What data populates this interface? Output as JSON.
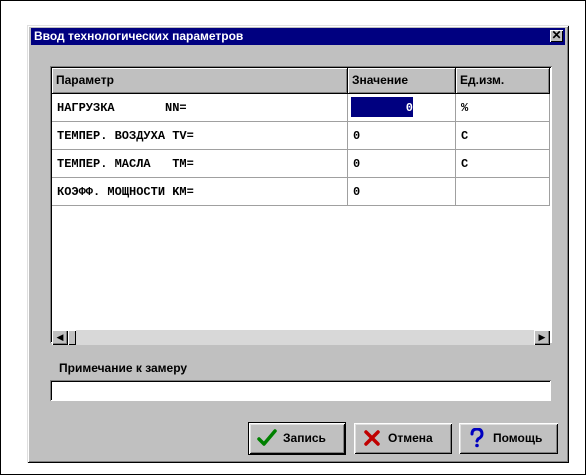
{
  "dialog": {
    "title": "Ввод технологических параметров",
    "close_icon": "close-icon"
  },
  "table": {
    "headers": {
      "param": "Параметр",
      "value": "Значение",
      "unit": "Ед.изм."
    },
    "rows": [
      {
        "param": "НАГРУЗКА       NN=",
        "value": "0",
        "unit": "%"
      },
      {
        "param": "ТЕМПЕР. ВОЗДУХА TV=",
        "value": "0",
        "unit": "C"
      },
      {
        "param": "ТЕМПЕР. МАСЛА   TM=",
        "value": "0",
        "unit": "C"
      },
      {
        "param": "КОЭФФ. МОЩНОСТИ KM=",
        "value": "0",
        "unit": ""
      }
    ],
    "selected_row": 0
  },
  "note": {
    "label": "Примечание к замеру",
    "value": ""
  },
  "buttons": {
    "save": {
      "label": "Запись",
      "icon": "checkmark-icon",
      "color": "#008000"
    },
    "cancel": {
      "label": "Отмена",
      "icon": "x-icon",
      "color": "#c00000"
    },
    "help": {
      "label": "Помощь",
      "icon": "question-icon",
      "color": "#0000c0"
    }
  },
  "colors": {
    "titlebar": "#000080",
    "face": "#c0c0c0",
    "selection": "#000080"
  }
}
